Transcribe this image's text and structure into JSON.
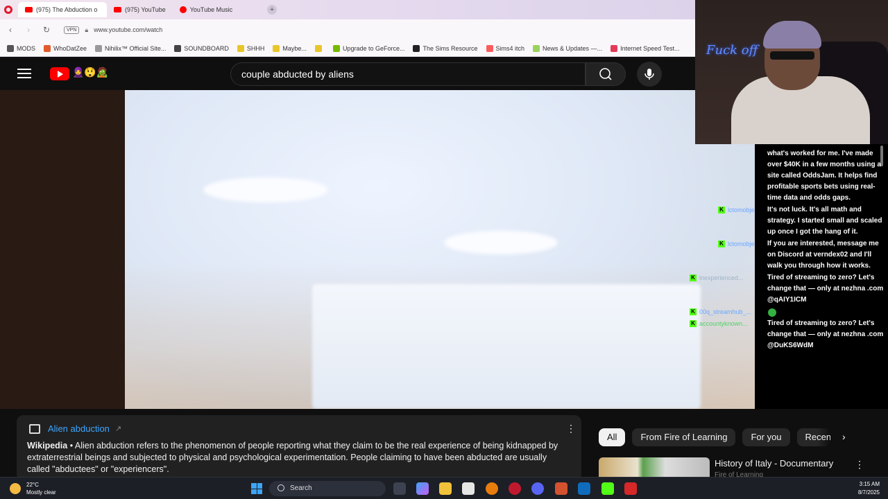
{
  "browser": {
    "tabs": [
      {
        "label": "(975) The Abduction o",
        "active": true
      },
      {
        "label": "(975) YouTube",
        "active": false
      },
      {
        "label": "YouTube Music",
        "active": false
      }
    ],
    "new_tab": "+",
    "url": "www.youtube.com/watch",
    "vpn_label": "VPN",
    "bookmarks": [
      "MODS",
      "WhoDatZee",
      "Nihilix™ Official Site...",
      "SOUNDBOARD",
      "SHHH",
      "Maybe...",
      "",
      "Upgrade to GeForce...",
      "The Sims Resource",
      "Sims4 itch",
      "News & Updates —...",
      "Internet Speed Test..."
    ]
  },
  "youtube": {
    "search_query": "couple abducted by aliens",
    "logo_emojis": "🧕😲🧟"
  },
  "webcam": {
    "sign_text": "Fuck off"
  },
  "chat": {
    "messages": [
      "what's worked for me. I've made over $40K in a few months using a site called OddsJam. It helps find profitable sports bets using real-time data and odds gaps.",
      "It's not luck. It's all math and strategy. I started small and scaled up once I got the hang of it.",
      "If you are interested, message me on Discord at verndex02 and I'll walk you through how it works.",
      "Tired of streaming to zero? Let's change that — only at nezhna .com @qAIY1ICM",
      "Tired of streaming to zero? Let's change that — only at nezhna .com @DuKS6WdM"
    ],
    "usernames": [
      "lctomobje",
      "lctomobje",
      "lnexperienced...",
      "00q_streamhub_...",
      "accountyknown..."
    ],
    "badge": "K"
  },
  "info_panel": {
    "title": "Alien abduction",
    "source": "Wikipedia",
    "separator": " • ",
    "text": "Alien abduction refers to the phenomenon of people reporting what they claim to be the real experience of being kidnapped by extraterrestrial beings and subjected to physical and psychological experimentation. People claiming to have been abducted are usually called \"abductees\" or \"experiencers\"."
  },
  "chips": [
    "All",
    "From Fire of Learning",
    "For you",
    "Recent"
  ],
  "recommendation": {
    "title": "History of Italy - Documentary",
    "channel": "Fire of Learning"
  },
  "taskbar": {
    "temperature": "22°C",
    "weather": "Mostly clear",
    "search_label": "Search",
    "time": "3:15 AM",
    "date": "8/7/2025"
  },
  "colors": {
    "youtube_red": "#ff0000",
    "link_blue": "#3ea6ff",
    "kick_green": "#53fc18"
  }
}
